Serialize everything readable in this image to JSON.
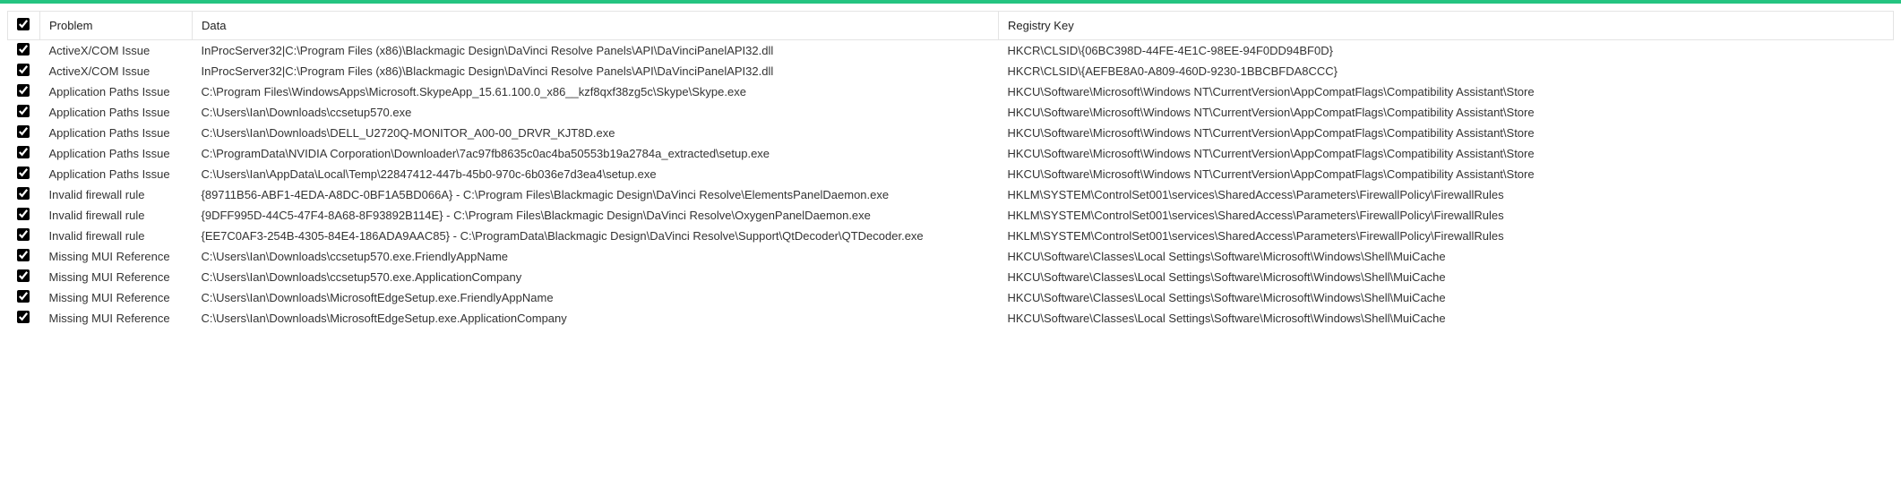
{
  "accent_color": "#25c481",
  "columns": {
    "problem": "Problem",
    "data": "Data",
    "registry_key": "Registry Key"
  },
  "rows": [
    {
      "checked": true,
      "problem": "ActiveX/COM Issue",
      "data": "InProcServer32|C:\\Program Files (x86)\\Blackmagic Design\\DaVinci Resolve Panels\\API\\DaVinciPanelAPI32.dll",
      "registry_key": "HKCR\\CLSID\\{06BC398D-44FE-4E1C-98EE-94F0DD94BF0D}"
    },
    {
      "checked": true,
      "problem": "ActiveX/COM Issue",
      "data": "InProcServer32|C:\\Program Files (x86)\\Blackmagic Design\\DaVinci Resolve Panels\\API\\DaVinciPanelAPI32.dll",
      "registry_key": "HKCR\\CLSID\\{AEFBE8A0-A809-460D-9230-1BBCBFDA8CCC}"
    },
    {
      "checked": true,
      "problem": "Application Paths Issue",
      "data": "C:\\Program Files\\WindowsApps\\Microsoft.SkypeApp_15.61.100.0_x86__kzf8qxf38zg5c\\Skype\\Skype.exe",
      "registry_key": "HKCU\\Software\\Microsoft\\Windows NT\\CurrentVersion\\AppCompatFlags\\Compatibility Assistant\\Store"
    },
    {
      "checked": true,
      "problem": "Application Paths Issue",
      "data": "C:\\Users\\Ian\\Downloads\\ccsetup570.exe",
      "registry_key": "HKCU\\Software\\Microsoft\\Windows NT\\CurrentVersion\\AppCompatFlags\\Compatibility Assistant\\Store"
    },
    {
      "checked": true,
      "problem": "Application Paths Issue",
      "data": "C:\\Users\\Ian\\Downloads\\DELL_U2720Q-MONITOR_A00-00_DRVR_KJT8D.exe",
      "registry_key": "HKCU\\Software\\Microsoft\\Windows NT\\CurrentVersion\\AppCompatFlags\\Compatibility Assistant\\Store"
    },
    {
      "checked": true,
      "problem": "Application Paths Issue",
      "data": "C:\\ProgramData\\NVIDIA Corporation\\Downloader\\7ac97fb8635c0ac4ba50553b19a2784a_extracted\\setup.exe",
      "registry_key": "HKCU\\Software\\Microsoft\\Windows NT\\CurrentVersion\\AppCompatFlags\\Compatibility Assistant\\Store"
    },
    {
      "checked": true,
      "problem": "Application Paths Issue",
      "data": "C:\\Users\\Ian\\AppData\\Local\\Temp\\22847412-447b-45b0-970c-6b036e7d3ea4\\setup.exe",
      "registry_key": "HKCU\\Software\\Microsoft\\Windows NT\\CurrentVersion\\AppCompatFlags\\Compatibility Assistant\\Store"
    },
    {
      "checked": true,
      "problem": "Invalid firewall rule",
      "data": "{89711B56-ABF1-4EDA-A8DC-0BF1A5BD066A} - C:\\Program Files\\Blackmagic Design\\DaVinci Resolve\\ElementsPanelDaemon.exe",
      "registry_key": "HKLM\\SYSTEM\\ControlSet001\\services\\SharedAccess\\Parameters\\FirewallPolicy\\FirewallRules"
    },
    {
      "checked": true,
      "problem": "Invalid firewall rule",
      "data": "{9DFF995D-44C5-47F4-8A68-8F93892B114E} - C:\\Program Files\\Blackmagic Design\\DaVinci Resolve\\OxygenPanelDaemon.exe",
      "registry_key": "HKLM\\SYSTEM\\ControlSet001\\services\\SharedAccess\\Parameters\\FirewallPolicy\\FirewallRules"
    },
    {
      "checked": true,
      "problem": "Invalid firewall rule",
      "data": "{EE7C0AF3-254B-4305-84E4-186ADA9AAC85} - C:\\ProgramData\\Blackmagic Design\\DaVinci Resolve\\Support\\QtDecoder\\QTDecoder.exe",
      "registry_key": "HKLM\\SYSTEM\\ControlSet001\\services\\SharedAccess\\Parameters\\FirewallPolicy\\FirewallRules"
    },
    {
      "checked": true,
      "problem": "Missing MUI Reference",
      "data": "C:\\Users\\Ian\\Downloads\\ccsetup570.exe.FriendlyAppName",
      "registry_key": "HKCU\\Software\\Classes\\Local Settings\\Software\\Microsoft\\Windows\\Shell\\MuiCache"
    },
    {
      "checked": true,
      "problem": "Missing MUI Reference",
      "data": "C:\\Users\\Ian\\Downloads\\ccsetup570.exe.ApplicationCompany",
      "registry_key": "HKCU\\Software\\Classes\\Local Settings\\Software\\Microsoft\\Windows\\Shell\\MuiCache"
    },
    {
      "checked": true,
      "problem": "Missing MUI Reference",
      "data": "C:\\Users\\Ian\\Downloads\\MicrosoftEdgeSetup.exe.FriendlyAppName",
      "registry_key": "HKCU\\Software\\Classes\\Local Settings\\Software\\Microsoft\\Windows\\Shell\\MuiCache"
    },
    {
      "checked": true,
      "problem": "Missing MUI Reference",
      "data": "C:\\Users\\Ian\\Downloads\\MicrosoftEdgeSetup.exe.ApplicationCompany",
      "registry_key": "HKCU\\Software\\Classes\\Local Settings\\Software\\Microsoft\\Windows\\Shell\\MuiCache"
    }
  ]
}
